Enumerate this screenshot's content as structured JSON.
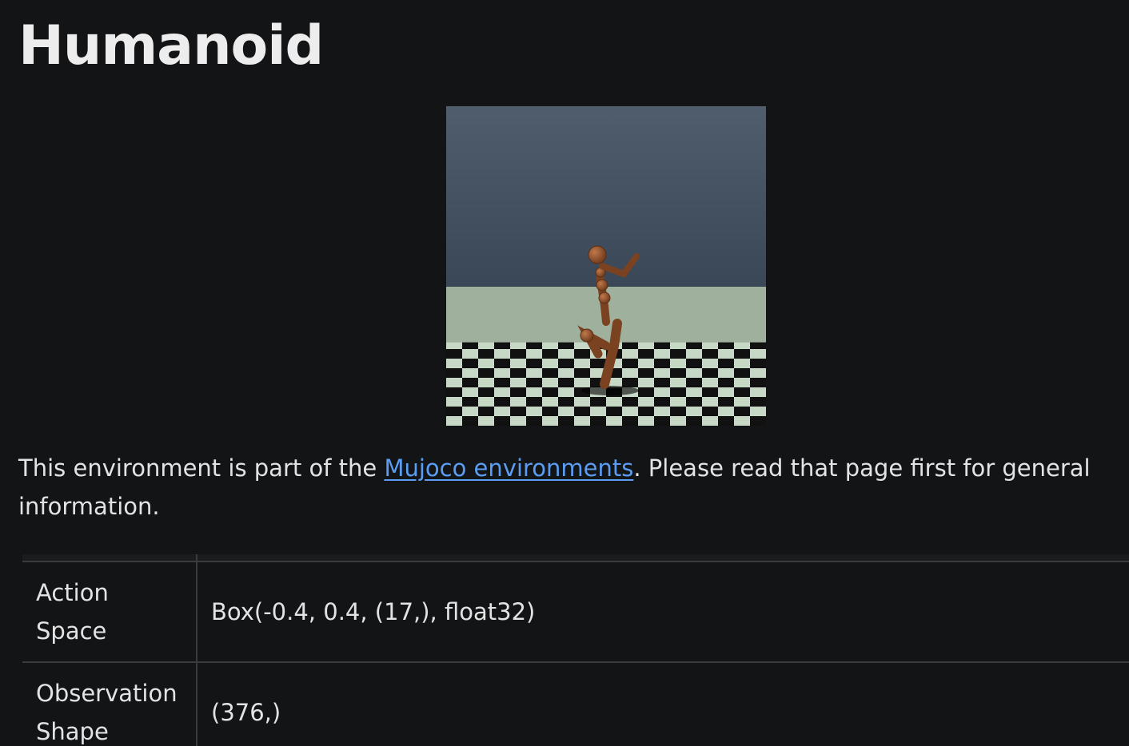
{
  "page": {
    "title": "Humanoid"
  },
  "intro": {
    "prefix": "This environment is part of the ",
    "link_text": "Mujoco environments",
    "suffix": ". Please read that page first for general information."
  },
  "table": {
    "rows": [
      {
        "key_line1": "Action",
        "key_line2": "Space",
        "value": "Box(-0.4, 0.4, (17,), float32)"
      },
      {
        "key_line1": "Observation",
        "key_line2": "Shape",
        "value": "(376,)"
      }
    ]
  },
  "colors": {
    "background": "#131416",
    "link": "#5a9df2",
    "border": "#3a3b3e"
  }
}
